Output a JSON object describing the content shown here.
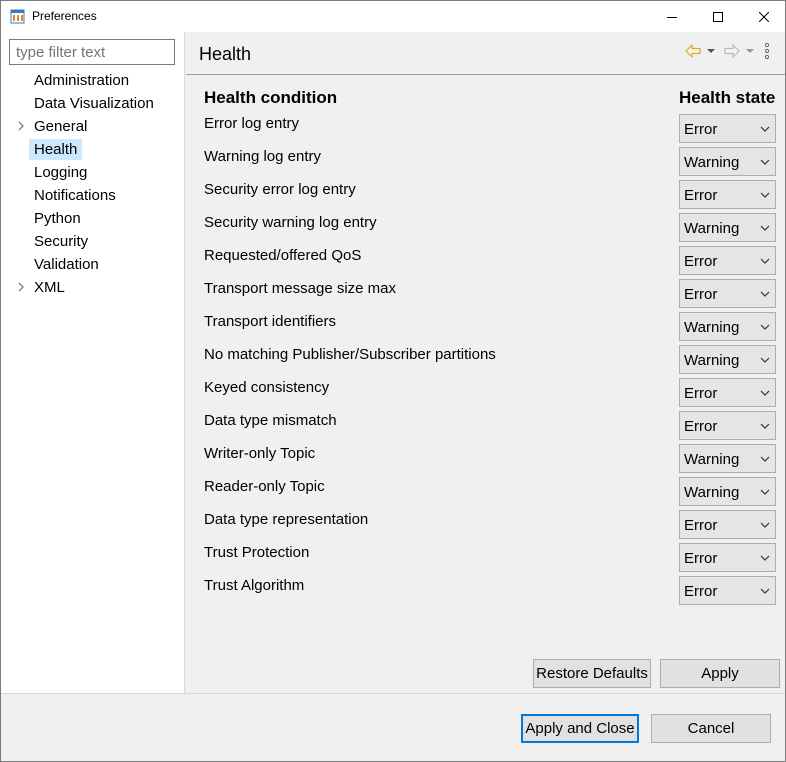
{
  "window": {
    "title": "Preferences"
  },
  "filter": {
    "placeholder": "type filter text",
    "value": ""
  },
  "tree": {
    "items": [
      {
        "label": "Administration",
        "expandable": false,
        "selected": false
      },
      {
        "label": "Data Visualization",
        "expandable": false,
        "selected": false
      },
      {
        "label": "General",
        "expandable": true,
        "selected": false
      },
      {
        "label": "Health",
        "expandable": false,
        "selected": true
      },
      {
        "label": "Logging",
        "expandable": false,
        "selected": false
      },
      {
        "label": "Notifications",
        "expandable": false,
        "selected": false
      },
      {
        "label": "Python",
        "expandable": false,
        "selected": false
      },
      {
        "label": "Security",
        "expandable": false,
        "selected": false
      },
      {
        "label": "Validation",
        "expandable": false,
        "selected": false
      },
      {
        "label": "XML",
        "expandable": true,
        "selected": false
      }
    ]
  },
  "page": {
    "title": "Health",
    "column_condition": "Health condition",
    "column_state": "Health state",
    "rows": [
      {
        "condition": "Error log entry",
        "state": "Error"
      },
      {
        "condition": "Warning log entry",
        "state": "Warning"
      },
      {
        "condition": "Security error log entry",
        "state": "Error"
      },
      {
        "condition": "Security warning log entry",
        "state": "Warning"
      },
      {
        "condition": "Requested/offered QoS",
        "state": "Error"
      },
      {
        "condition": "Transport message size max",
        "state": "Error"
      },
      {
        "condition": "Transport identifiers",
        "state": "Warning"
      },
      {
        "condition": "No matching Publisher/Subscriber partitions",
        "state": "Warning"
      },
      {
        "condition": "Keyed consistency",
        "state": "Error"
      },
      {
        "condition": "Data type mismatch",
        "state": "Error"
      },
      {
        "condition": "Writer-only Topic",
        "state": "Warning"
      },
      {
        "condition": "Reader-only Topic",
        "state": "Warning"
      },
      {
        "condition": "Data type representation",
        "state": "Error"
      },
      {
        "condition": "Trust Protection",
        "state": "Error"
      },
      {
        "condition": "Trust Algorithm",
        "state": "Error"
      }
    ],
    "restore_defaults_label": "Restore Defaults",
    "apply_label": "Apply"
  },
  "footer": {
    "apply_and_close_label": "Apply and Close",
    "cancel_label": "Cancel"
  },
  "colors": {
    "selection": "#cce8ff",
    "nav_back_arrow": "#d9a441",
    "nav_fwd_arrow": "#b8b8b8",
    "default_button_border": "#0078d7"
  },
  "icons": {
    "app": "preferences-app-icon",
    "minimize": "minimize-icon",
    "maximize": "maximize-icon",
    "close": "close-icon",
    "back": "back-arrow-icon",
    "forward": "forward-arrow-icon",
    "view_menu": "view-menu-icon"
  }
}
